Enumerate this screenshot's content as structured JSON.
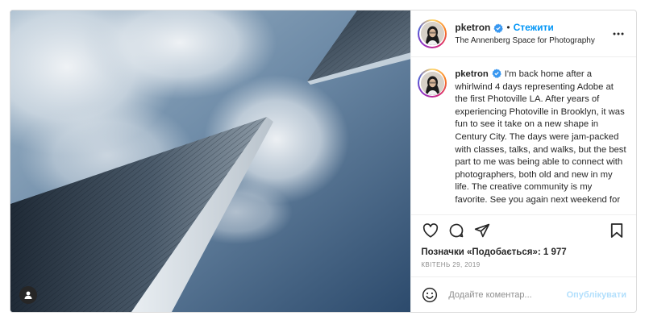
{
  "post": {
    "username": "pketron",
    "follow_label": "Стежити",
    "separator": "•",
    "location": "The Annenberg Space for Photography",
    "more_icon": "more-dots-icon",
    "caption": "I'm back home after a whirlwind 4 days representing Adobe at the first Photoville LA. After years of experiencing Photoville in Brooklyn, it was fun to see it take on a new shape in Century City. The days were jam-packed with classes, talks, and walks, but the best part to me was being able to connect with photographers, both old and new in my life. The creative community is my favorite. See you again next weekend for another",
    "likes_text": "Позначки «Подобається»: 1 977",
    "date": "Квітень 29, 2019"
  },
  "comment": {
    "placeholder": "Додайте коментар...",
    "publish_label": "Опублікувати"
  },
  "icons": {
    "like": "heart-icon",
    "comment": "comment-icon",
    "share": "paper-plane-icon",
    "save": "bookmark-icon",
    "emoji": "smiley-icon",
    "tag": "user-tag-icon",
    "verified": "verified-badge-icon"
  },
  "colors": {
    "accent": "#0095f6",
    "publish_disabled": "#b2dffc",
    "verified": "#3897f0"
  }
}
